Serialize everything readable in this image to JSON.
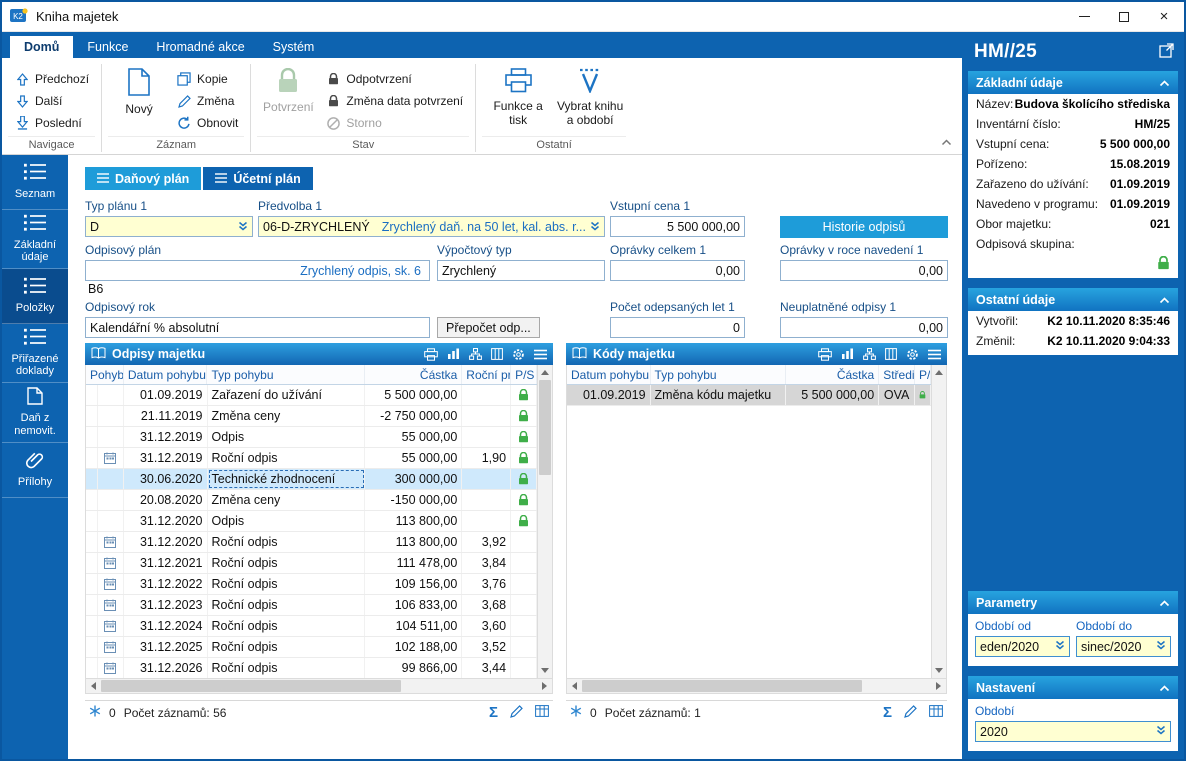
{
  "window": {
    "title": "Kniha majetek"
  },
  "ribbon": {
    "tabs": [
      {
        "label": "Domů",
        "active": true
      },
      {
        "label": "Funkce",
        "active": false
      },
      {
        "label": "Hromadné akce",
        "active": false
      },
      {
        "label": "Systém",
        "active": false
      }
    ],
    "navigace": {
      "label": "Navigace",
      "prev": "Předchozí",
      "next": "Další",
      "last": "Poslední"
    },
    "zaznam": {
      "label": "Záznam",
      "novy": "Nový",
      "kopie": "Kopie",
      "zmena": "Změna",
      "obnovit": "Obnovit"
    },
    "stav": {
      "label": "Stav",
      "potvrzeni": "Potvrzení",
      "odpotvrzeni": "Odpotvrzení",
      "zmena_data": "Změna data potvrzení",
      "storno": "Storno"
    },
    "ostatni": {
      "label": "Ostatní",
      "funkce_tisk": "Funkce a tisk",
      "vybrat": "Vybrat knihu a období"
    }
  },
  "sidebar": {
    "items": [
      {
        "label": "Seznam",
        "icon": "list-icon",
        "active": false
      },
      {
        "label": "Základní údaje",
        "icon": "list-icon",
        "active": false
      },
      {
        "label": "Položky",
        "icon": "list-icon",
        "active": true
      },
      {
        "label": "Přiřazené doklady",
        "icon": "list-icon",
        "active": false
      },
      {
        "label": "Daň z nemovit.",
        "icon": "document-icon",
        "active": false
      },
      {
        "label": "Přílohy",
        "icon": "paperclip-icon",
        "active": false
      }
    ]
  },
  "plan_tabs": [
    {
      "label": "Daňový plán",
      "active": true
    },
    {
      "label": "Účetní plán",
      "active": false
    }
  ],
  "form": {
    "typ_planu": {
      "label": "Typ plánu 1",
      "value": "D"
    },
    "predvolba": {
      "label": "Předvolba 1",
      "code": "06-D-ZRYCHLENÝ",
      "desc": "Zrychlený daň. na 50 let, kal. abs. r..."
    },
    "vstupni_cena": {
      "label": "Vstupní cena 1",
      "value": "5 500 000,00"
    },
    "historie_button": "Historie odpisů",
    "odpisovy_plan": {
      "label": "Odpisový plán",
      "desc": "Zrychlený odpis, sk. 6",
      "code": "B6"
    },
    "vypoctovy_typ": {
      "label": "Výpočtový typ",
      "value": "Zrychlený"
    },
    "opravky_celkem": {
      "label": "Oprávky celkem 1",
      "value": "0,00"
    },
    "opravky_v_roce": {
      "label": "Oprávky v roce navedení 1",
      "value": "0,00"
    },
    "odpisovy_rok": {
      "label": "Odpisový rok",
      "value": "Kalendářní % absolutní"
    },
    "prepocet_button": "Přepočet odp...",
    "pocet_let": {
      "label": "Počet odepsaných let 1",
      "value": "0"
    },
    "neuplatnene": {
      "label": "Neuplatněné odpisy 1",
      "value": "0,00"
    }
  },
  "odpisy_grid": {
    "title": "Odpisy majetku",
    "columns": [
      "Pohyb",
      "Datum pohybu",
      "Typ pohybu",
      "Částka",
      "Roční pr",
      "P/S"
    ],
    "selected_index": 4,
    "rows": [
      {
        "cal": false,
        "datum": "01.09.2019",
        "typ": "Zařazení do užívání",
        "castka": "5 500 000,00",
        "rocni": "",
        "lock": true
      },
      {
        "cal": false,
        "datum": "21.11.2019",
        "typ": "Změna ceny",
        "castka": "-2 750 000,00",
        "rocni": "",
        "lock": true
      },
      {
        "cal": false,
        "datum": "31.12.2019",
        "typ": "Odpis",
        "castka": "55 000,00",
        "rocni": "",
        "lock": true
      },
      {
        "cal": true,
        "datum": "31.12.2019",
        "typ": "Roční odpis",
        "castka": "55 000,00",
        "rocni": "1,90",
        "lock": true
      },
      {
        "cal": false,
        "datum": "30.06.2020",
        "typ": "Technické zhodnocení",
        "castka": "300 000,00",
        "rocni": "",
        "lock": true
      },
      {
        "cal": false,
        "datum": "20.08.2020",
        "typ": "Změna ceny",
        "castka": "-150 000,00",
        "rocni": "",
        "lock": true
      },
      {
        "cal": false,
        "datum": "31.12.2020",
        "typ": "Odpis",
        "castka": "113 800,00",
        "rocni": "",
        "lock": true
      },
      {
        "cal": true,
        "datum": "31.12.2020",
        "typ": "Roční odpis",
        "castka": "113 800,00",
        "rocni": "3,92",
        "lock": false
      },
      {
        "cal": true,
        "datum": "31.12.2021",
        "typ": "Roční odpis",
        "castka": "111 478,00",
        "rocni": "3,84",
        "lock": false
      },
      {
        "cal": true,
        "datum": "31.12.2022",
        "typ": "Roční odpis",
        "castka": "109 156,00",
        "rocni": "3,76",
        "lock": false
      },
      {
        "cal": true,
        "datum": "31.12.2023",
        "typ": "Roční odpis",
        "castka": "106 833,00",
        "rocni": "3,68",
        "lock": false
      },
      {
        "cal": true,
        "datum": "31.12.2024",
        "typ": "Roční odpis",
        "castka": "104 511,00",
        "rocni": "3,60",
        "lock": false
      },
      {
        "cal": true,
        "datum": "31.12.2025",
        "typ": "Roční odpis",
        "castka": "102 188,00",
        "rocni": "3,52",
        "lock": false
      },
      {
        "cal": true,
        "datum": "31.12.2026",
        "typ": "Roční odpis",
        "castka": "99 866,00",
        "rocni": "3,44",
        "lock": false
      }
    ],
    "status": {
      "flag_count": "0",
      "records": "Počet záznamů: 56"
    }
  },
  "kody_grid": {
    "title": "Kódy majetku",
    "columns": [
      "Datum pohybu",
      "Typ pohybu",
      "Částka",
      "Středi:",
      "P/S"
    ],
    "selected_index": 0,
    "rows": [
      {
        "datum": "01.09.2019",
        "typ": "Změna kódu majetku",
        "castka": "5 500 000,00",
        "stredisko": "OVA",
        "lock": true
      }
    ],
    "status": {
      "flag_count": "0",
      "records": "Počet záznamů: 1"
    }
  },
  "side_panel": {
    "title": "HM//25",
    "zakladni_udaje": {
      "header": "Základní údaje",
      "rows": [
        {
          "label": "Název:",
          "value": "Budova školícího střediska"
        },
        {
          "label": "Inventární číslo:",
          "value": "HM/25"
        },
        {
          "label": "Vstupní cena:",
          "value": "5 500 000,00"
        },
        {
          "label": "Pořízeno:",
          "value": "15.08.2019"
        },
        {
          "label": "Zařazeno do užívání:",
          "value": "01.09.2019"
        },
        {
          "label": "Navedeno v programu:",
          "value": "01.09.2019"
        },
        {
          "label": "Obor majetku:",
          "value": "021"
        },
        {
          "label": "Odpisová skupina:",
          "value": ""
        }
      ]
    },
    "ostatni_udaje": {
      "header": "Ostatní údaje",
      "rows": [
        {
          "label": "Vytvořil:",
          "value": "K2 10.11.2020 8:35:46"
        },
        {
          "label": "Změnil:",
          "value": "K2 10.11.2020 9:04:33"
        }
      ]
    },
    "parametry": {
      "header": "Parametry",
      "obdobi_od": {
        "label": "Období od",
        "value": "eden/2020"
      },
      "obdobi_do": {
        "label": "Období do",
        "value": "sinec/2020"
      }
    },
    "nastaveni": {
      "header": "Nastavení",
      "obdobi": {
        "label": "Období",
        "value": "2020"
      }
    }
  },
  "colors": {
    "primary_blue": "#0d63b0",
    "accent_cyan": "#1e9cd9",
    "input_yellow": "#ffffd2",
    "lock_green": "#3fae49",
    "selected_row": "#cfe9fc"
  }
}
